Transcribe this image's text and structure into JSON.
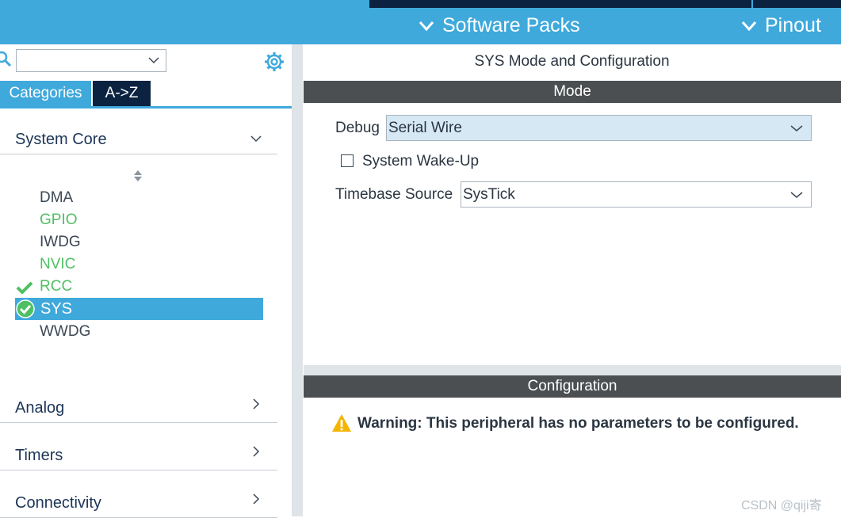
{
  "topbar": {
    "menus": [
      {
        "label": "Software Packs"
      },
      {
        "label": "Pinout"
      }
    ]
  },
  "sidebar": {
    "search": {
      "value": "",
      "placeholder": ""
    },
    "tabs": [
      {
        "label": "Categories",
        "active": true
      },
      {
        "label": "A->Z",
        "active": false
      }
    ],
    "sections": [
      {
        "label": "System Core",
        "expanded": true
      },
      {
        "label": "Analog",
        "expanded": false
      },
      {
        "label": "Timers",
        "expanded": false
      },
      {
        "label": "Connectivity",
        "expanded": false
      }
    ],
    "items": [
      {
        "label": "DMA",
        "state": "default"
      },
      {
        "label": "GPIO",
        "state": "configured"
      },
      {
        "label": "IWDG",
        "state": "default"
      },
      {
        "label": "NVIC",
        "state": "configured"
      },
      {
        "label": "RCC",
        "state": "checked"
      },
      {
        "label": "SYS",
        "state": "selected"
      },
      {
        "label": "WWDG",
        "state": "default"
      }
    ]
  },
  "main": {
    "title": "SYS Mode and Configuration",
    "mode_header": "Mode",
    "debug": {
      "label": "Debug",
      "value": "Serial Wire"
    },
    "wakeup": {
      "label": "System Wake-Up",
      "checked": false
    },
    "timebase": {
      "label": "Timebase Source",
      "value": "SysTick"
    },
    "config_header": "Configuration",
    "warning": "Warning: This peripheral has no parameters to be configured."
  },
  "watermark": "CSDN @qiji寄",
  "colors": {
    "accent": "#3fa9dc",
    "navy": "#0b2341",
    "header_bar": "#4b4f52",
    "ok_green": "#4fbf63",
    "warning_yellow": "#f5b400"
  }
}
